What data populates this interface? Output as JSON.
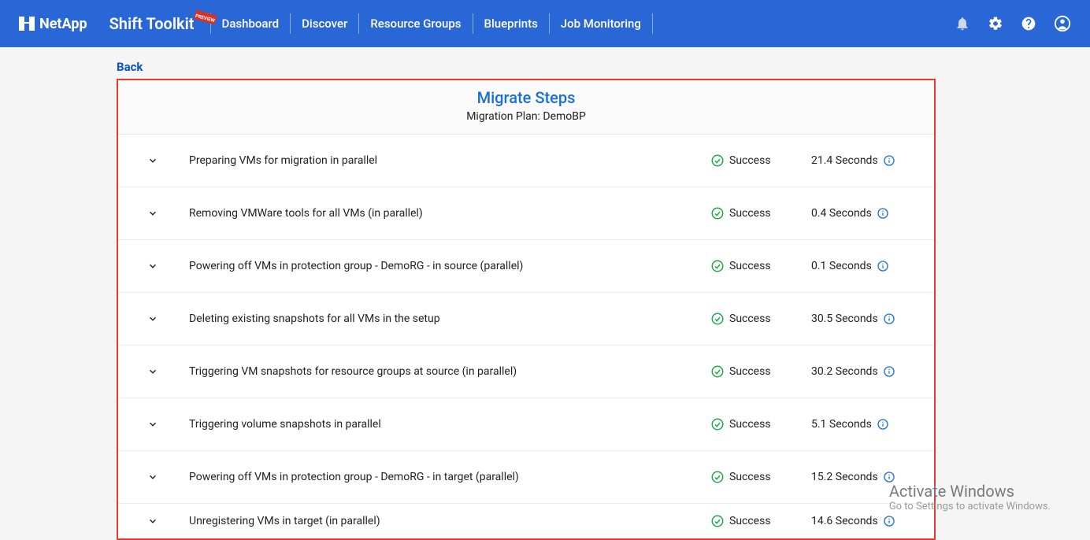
{
  "header": {
    "brand": "NetApp",
    "product": "Shift Toolkit",
    "nav": [
      "Dashboard",
      "Discover",
      "Resource Groups",
      "Blueprints",
      "Job Monitoring"
    ]
  },
  "back_label": "Back",
  "panel": {
    "title": "Migrate Steps",
    "subtitle": "Migration Plan: DemoBP"
  },
  "status_label": "Success",
  "steps": [
    {
      "desc": "Preparing VMs for migration in parallel",
      "duration": "21.4 Seconds"
    },
    {
      "desc": "Removing VMWare tools for all VMs (in parallel)",
      "duration": "0.4 Seconds"
    },
    {
      "desc": "Powering off VMs in protection group - DemoRG - in source (parallel)",
      "duration": "0.1 Seconds"
    },
    {
      "desc": "Deleting existing snapshots for all VMs in the setup",
      "duration": "30.5 Seconds"
    },
    {
      "desc": "Triggering VM snapshots for resource groups at source (in parallel)",
      "duration": "30.2 Seconds"
    },
    {
      "desc": "Triggering volume snapshots in parallel",
      "duration": "5.1 Seconds"
    },
    {
      "desc": "Powering off VMs in protection group - DemoRG - in target (parallel)",
      "duration": "15.2 Seconds"
    },
    {
      "desc": "Unregistering VMs in target (in parallel)",
      "duration": "14.6 Seconds"
    }
  ],
  "watermark": {
    "line1": "Activate Windows",
    "line2": "Go to Settings to activate Windows."
  }
}
